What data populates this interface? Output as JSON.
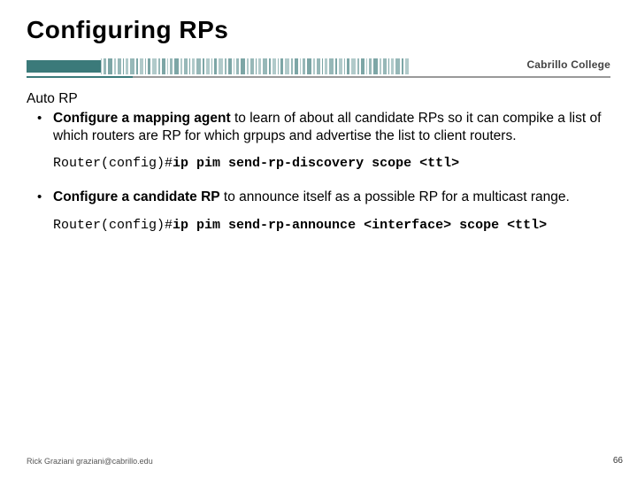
{
  "title": "Configuring RPs",
  "college": "Cabrillo College",
  "subhead": "Auto RP",
  "bullet1": {
    "bold": "Configure a mapping agent",
    "rest": " to learn of about all candidate RPs so it can compike a list of which routers are RP for which grpups and advertise the list to client routers."
  },
  "code1": {
    "prompt": "Router(config)#",
    "cmd": "ip pim send-rp-discovery scope <ttl>"
  },
  "bullet2": {
    "bold": "Configure a candidate RP",
    "rest": " to announce itself as a possible RP for a multicast range."
  },
  "code2": {
    "prompt": "Router(config)#",
    "cmd": "ip pim send-rp-announce <interface> scope <ttl>"
  },
  "footer": "Rick Graziani  graziani@cabrillo.edu",
  "pagenum": "66"
}
